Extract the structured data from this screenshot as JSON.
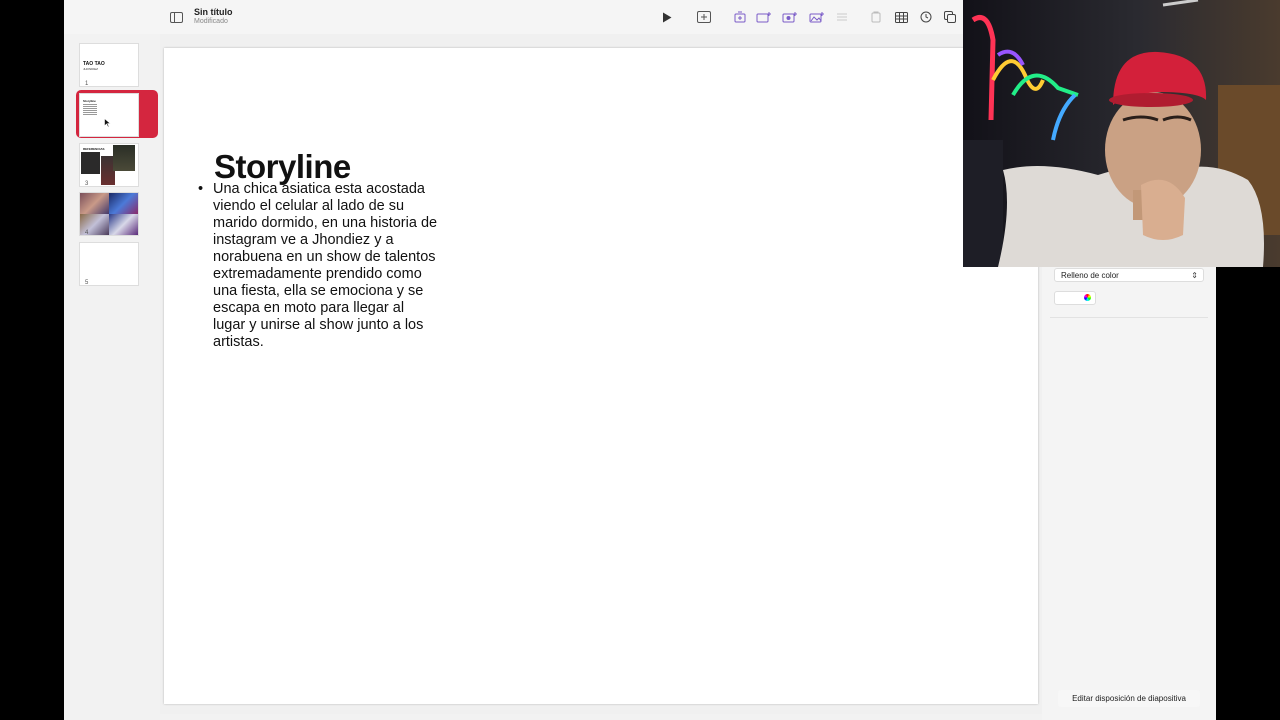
{
  "toolbar": {
    "doc_title": "Sin título",
    "doc_subtitle": "Modificado",
    "icons": [
      "sidebar-icon",
      "play-icon",
      "add-slide-icon",
      "animate-icon",
      "chart-icon",
      "media-icon",
      "photo-icon",
      "text-icon",
      "shape-icon",
      "table-icon",
      "timer-icon",
      "copy-icon"
    ]
  },
  "navigator": {
    "slides": [
      {
        "number": "1",
        "title": "TAO TAO",
        "subtitle": "JHONDIEZ",
        "selected": false
      },
      {
        "number": "2",
        "title": "Storyline",
        "selected": true
      },
      {
        "number": "3",
        "title": "REFERENCIAS",
        "selected": false
      },
      {
        "number": "4",
        "selected": false
      },
      {
        "number": "5",
        "selected": false
      }
    ]
  },
  "slide": {
    "title": "Storyline",
    "bullet_marker": "•",
    "bullet": "Una chica asiatica esta acostada viendo el celular al lado de su marido dormido, en una historia de instagram ve a Jhondiez y a norabuena en un show de talentos extremadamente prendido como una fiesta, ella se emociona y se escapa en moto para llegar al lugar y unirse al show junto a los artistas."
  },
  "inspector": {
    "fill_select": "Relleno de color",
    "fill_chevron": "⌃",
    "edit_layout_button": "Editar disposición de diapositiva"
  },
  "colors": {
    "selection": "#d4263f",
    "cap_red": "#d3203a"
  }
}
